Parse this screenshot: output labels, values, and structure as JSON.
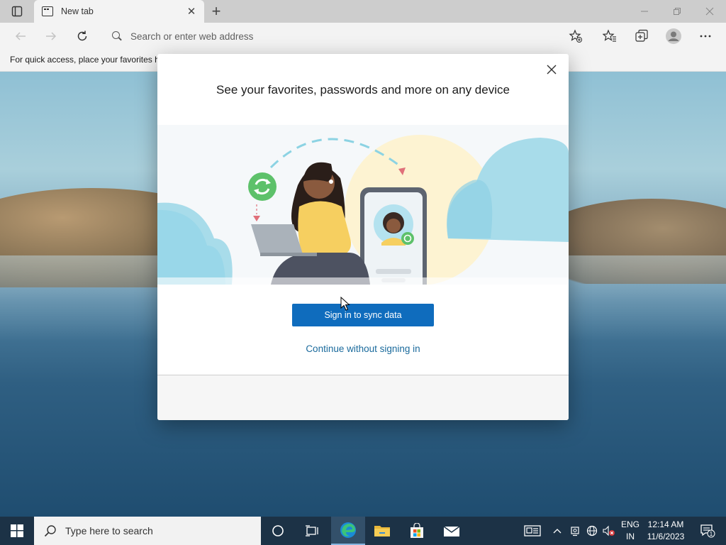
{
  "browser": {
    "tab_title": "New tab",
    "address_placeholder": "Search or enter web address",
    "favorites_bar_text": "For quick access, place your favorites h"
  },
  "dialog": {
    "title": "See your favorites, passwords and more on any device",
    "primary_button": "Sign in to sync data",
    "secondary_link": "Continue without signing in"
  },
  "taskbar": {
    "search_placeholder": "Type here to search",
    "language_line1": "ENG",
    "language_line2": "IN",
    "time": "12:14 AM",
    "date": "11/6/2023",
    "notification_count": "1"
  },
  "colors": {
    "accent": "#0f6cbd",
    "link": "#1a6a9c",
    "taskbar": "#1c3246",
    "chrome": "#f3f3f3"
  }
}
